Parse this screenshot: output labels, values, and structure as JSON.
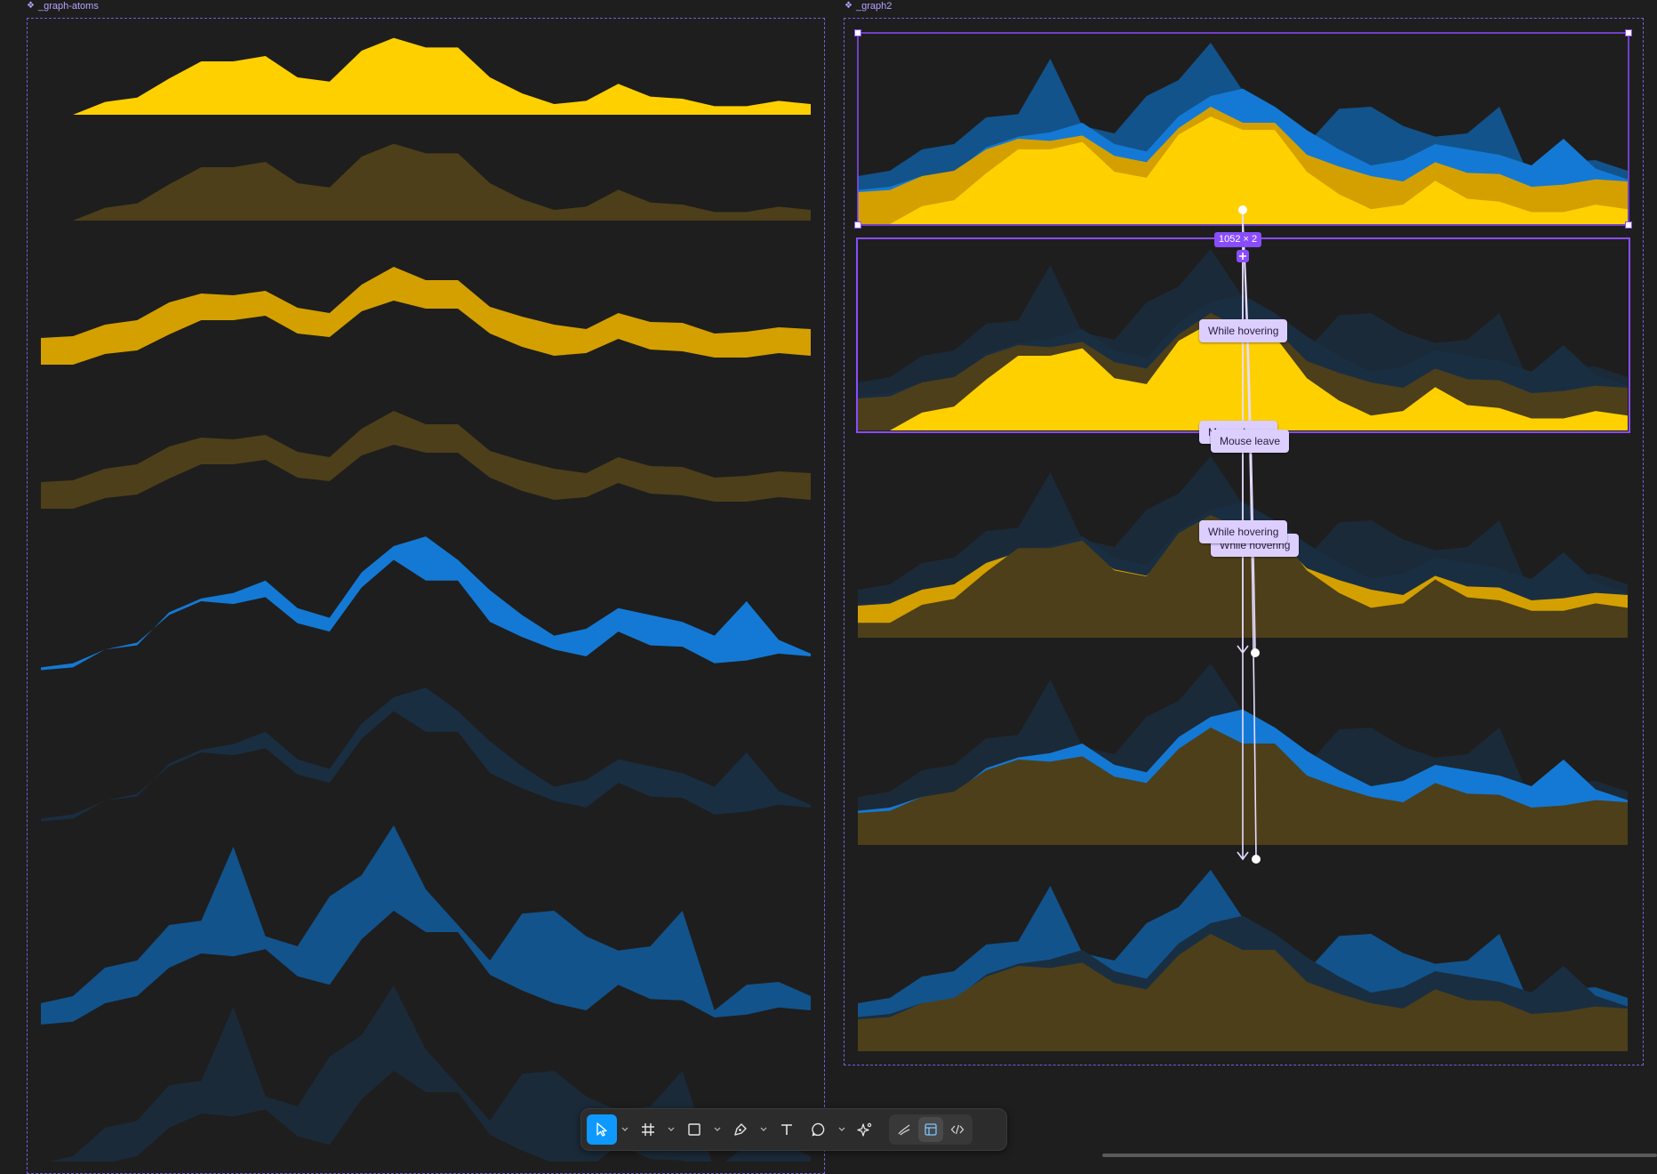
{
  "frames": {
    "left": {
      "label": "_graph-atoms"
    },
    "right": {
      "label": "_graph2"
    }
  },
  "colors": {
    "yellow": "#ffd000",
    "gold": "#d4a000",
    "olive": "#4d3f1a",
    "blue": "#1479d4",
    "navy": "#12538c",
    "darkNavy": "#1a2e42",
    "dimBlue": "#1b2a38",
    "selection": "#8a4cff",
    "prototypeLine": "#e6dcff"
  },
  "prototype": {
    "badge": "1052 × 2",
    "interactions": [
      "While hovering",
      "Mouse leave",
      "While hovering",
      "Mouse leave",
      "While hovering",
      "Mouse leave"
    ]
  },
  "toolbar": {
    "tools": [
      {
        "name": "move-tool",
        "icon": "cursor-icon"
      },
      {
        "name": "frame-tool",
        "icon": "hash-icon"
      },
      {
        "name": "shape-tool",
        "icon": "square-icon"
      },
      {
        "name": "pen-tool",
        "icon": "pen-icon"
      },
      {
        "name": "text-tool",
        "icon": "text-icon"
      },
      {
        "name": "comment-tool",
        "icon": "comment-icon"
      },
      {
        "name": "ai-tool",
        "icon": "sparkle-icon"
      }
    ],
    "modes": [
      "draw-mode-icon",
      "design-mode-icon",
      "dev-mode-icon"
    ]
  },
  "series": {
    "top": [
      0,
      0,
      12,
      16,
      34,
      50,
      50,
      55,
      35,
      31,
      60,
      72,
      63,
      63,
      35,
      20,
      10,
      13,
      29,
      17,
      15,
      8,
      8,
      13,
      10
    ],
    "mid": [
      30,
      32,
      45,
      50,
      70,
      80,
      78,
      83,
      64,
      58,
      90,
      110,
      95,
      95,
      65,
      54,
      45,
      40,
      58,
      48,
      47,
      35,
      37,
      42,
      40
    ],
    "high": [
      32,
      35,
      45,
      48,
      72,
      82,
      86,
      95,
      75,
      68,
      101,
      120,
      127,
      110,
      88,
      70,
      55,
      60,
      75,
      70,
      65,
      55,
      80,
      52,
      42
    ],
    "peak": [
      45,
      50,
      70,
      75,
      100,
      103,
      155,
      92,
      85,
      120,
      135,
      170,
      125,
      100,
      75,
      108,
      110,
      92,
      82,
      85,
      110,
      40,
      58,
      60,
      50
    ]
  }
}
